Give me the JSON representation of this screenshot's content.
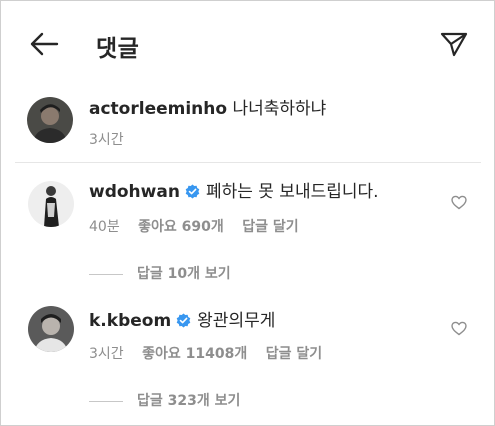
{
  "header": {
    "title": "댓글",
    "back_icon": "arrow-left-icon",
    "send_icon": "paper-plane-icon"
  },
  "caption": {
    "username": "actorleeminho",
    "text": "나너축하하냐",
    "time": "3시간"
  },
  "comments": [
    {
      "username": "wdohwan",
      "verified": true,
      "text": "폐하는 못 보내드립니다.",
      "time": "40분",
      "likes": "좋아요 690개",
      "reply": "답글 달기",
      "view_replies": "답글 10개 보기"
    },
    {
      "username": "k.kbeom",
      "verified": true,
      "text": "왕관의무게",
      "time": "3시간",
      "likes": "좋아요 11408개",
      "reply": "답글 달기",
      "view_replies": "답글 323개 보기"
    }
  ],
  "colors": {
    "verified_badge": "#3897f0",
    "meta_text": "#8e8e8e",
    "primary_text": "#262626"
  }
}
